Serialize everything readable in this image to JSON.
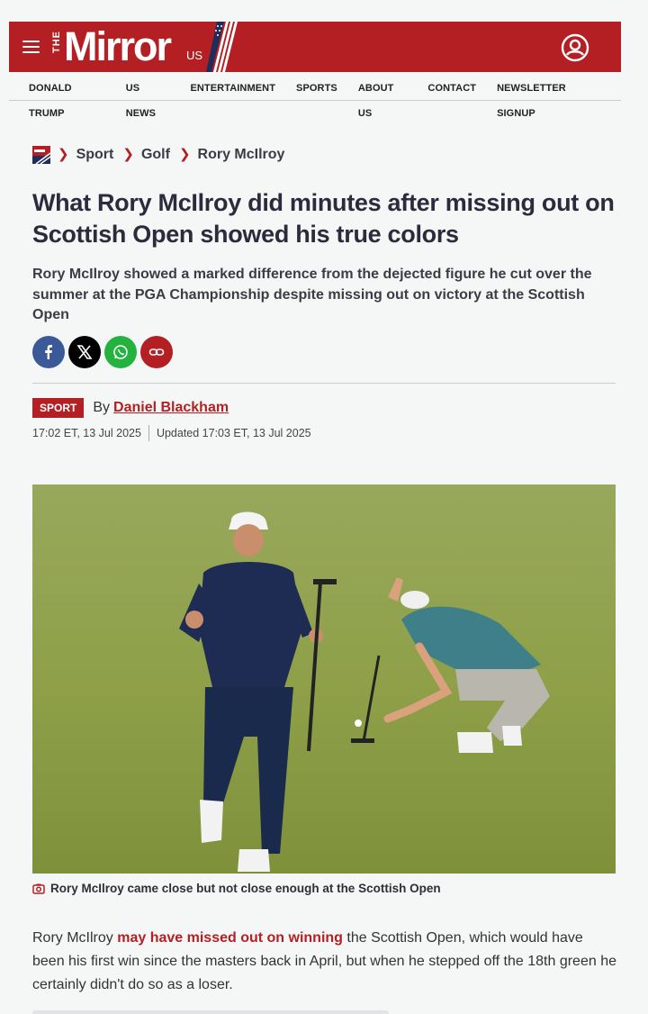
{
  "header": {
    "logo_the": "THE",
    "logo_word": "Mirror",
    "logo_us": "US",
    "brand_color": "#b31f22"
  },
  "nav": {
    "items": [
      "DONALD TRUMP",
      "US NEWS",
      "ENTERTAINMENT",
      "SPORTS",
      "ABOUT US",
      "CONTACT",
      "NEWSLETTER SIGNUP"
    ]
  },
  "breadcrumb": {
    "items": [
      "Sport",
      "Golf",
      "Rory McIlroy"
    ]
  },
  "article": {
    "headline": "What Rory McIlroy did minutes after missing out on Scottish Open showed his true colors",
    "standfirst": "Rory McIlroy showed a marked difference from the dejected figure he cut over the summer at the PGA Championship despite missing out on victory at the Scottish Open",
    "section_tag": "SPORT",
    "by_label": "By",
    "author": "Daniel Blackham",
    "published": "17:02 ET, 13 Jul 2025",
    "updated": "Updated 17:03 ET, 13 Jul 2025",
    "caption": "Rory McIlroy came close but not close enough at the Scottish Open",
    "body_pre": "Rory McIlroy ",
    "body_link": "may have missed out on winning",
    "body_post": " the Scottish Open, which would have been his first win since the masters back in April, but when he stepped off the 18th green he certainly didn't do so as a loser."
  },
  "share": {
    "icons": [
      "facebook-icon",
      "x-icon",
      "whatsapp-icon",
      "link-icon"
    ]
  }
}
